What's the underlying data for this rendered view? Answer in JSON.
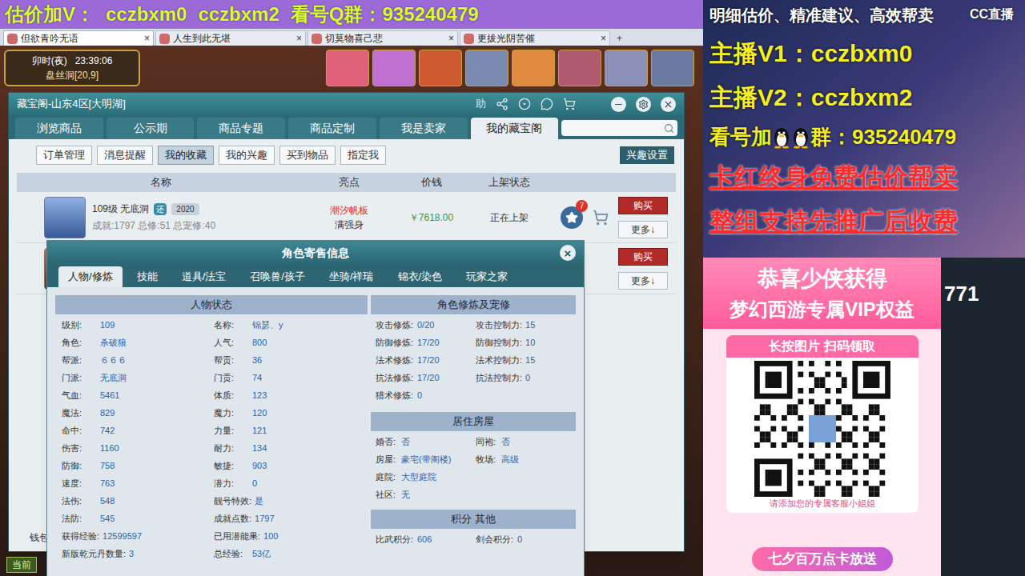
{
  "banner": {
    "label_v": "估价加V：",
    "v1": "cczbxm0",
    "v2": "cczbxm2",
    "label_q": "看号Q群：",
    "q": "935240479"
  },
  "browser_tabs": [
    {
      "label": "但欲青吟无语",
      "selected": true,
      "close": "×"
    },
    {
      "label": "人生到此无堪",
      "selected": false,
      "close": "×"
    },
    {
      "label": "切莫物喜己悲",
      "selected": false,
      "close": "×"
    },
    {
      "label": "更拔光阴苦催",
      "selected": false,
      "close": "×"
    }
  ],
  "new_tab": "+",
  "hud": {
    "period": "卯时(夜)",
    "clock": "23:39:06",
    "location": "盘丝洞[20,9]"
  },
  "window": {
    "title": "藏宝阁-山东4区[大明湖]",
    "help": "助"
  },
  "nav_tabs": [
    {
      "label": "浏览商品",
      "selected": false
    },
    {
      "label": "公示期",
      "selected": false
    },
    {
      "label": "商品专题",
      "selected": false
    },
    {
      "label": "商品定制",
      "selected": false
    },
    {
      "label": "我是卖家",
      "selected": false
    },
    {
      "label": "我的藏宝阁",
      "selected": true
    }
  ],
  "sub_tabs": [
    {
      "label": "订单管理",
      "selected": false
    },
    {
      "label": "消息提醒",
      "selected": false
    },
    {
      "label": "我的收藏",
      "selected": true
    },
    {
      "label": "我的兴趣",
      "selected": false
    },
    {
      "label": "买到物品",
      "selected": false
    },
    {
      "label": "指定我",
      "selected": false
    }
  ],
  "interest_button": "兴趣设置",
  "table": {
    "columns": [
      "名称",
      "亮点",
      "价钱",
      "上架状态"
    ],
    "rows": [
      {
        "title": "109级 无底洞",
        "badges": [
          "还",
          "2020"
        ],
        "summary": "成就:1797 总修:51 总宠修:40",
        "highlights": [
          {
            "text": "潮汐帆板",
            "color": "#e0302a"
          },
          {
            "text": "满强身",
            "color": "#333333"
          }
        ],
        "price": "￥7618.00",
        "status": "正在上架",
        "favorites": "7",
        "buy": "购买",
        "more": "更多↓"
      },
      {
        "title": "",
        "badges": [],
        "summary": "",
        "highlights": [],
        "price": "",
        "status": "",
        "favorites": "",
        "buy": "购买",
        "more": "更多↓"
      }
    ]
  },
  "dialog": {
    "title": "角色寄售信息",
    "close": "×",
    "tabs": [
      {
        "label": "人物/修炼",
        "selected": true
      },
      {
        "label": "技能",
        "selected": false
      },
      {
        "label": "道具/法宝",
        "selected": false
      },
      {
        "label": "召唤兽/孩子",
        "selected": false
      },
      {
        "label": "坐骑/祥瑞",
        "selected": false
      },
      {
        "label": "锦衣/染色",
        "selected": false
      },
      {
        "label": "玩家之家",
        "selected": false
      }
    ],
    "status": {
      "title": "人物状态",
      "rows": [
        [
          {
            "label": "级别:",
            "value": "109"
          },
          {
            "label": "名称:",
            "value": "锦瑟、y"
          }
        ],
        [
          {
            "label": "角色:",
            "value": "杀破狼"
          },
          {
            "label": "人气:",
            "value": "800"
          }
        ],
        [
          {
            "label": "帮派:",
            "value": "６６６"
          },
          {
            "label": "帮贡:",
            "value": "36"
          }
        ],
        [
          {
            "label": "门派:",
            "value": "无底洞"
          },
          {
            "label": "门贡:",
            "value": "74"
          }
        ],
        [
          {
            "label": "气血:",
            "value": "5461"
          },
          {
            "label": "体质:",
            "value": "123"
          }
        ],
        [
          {
            "label": "魔法:",
            "value": "829"
          },
          {
            "label": "魔力:",
            "value": "120"
          }
        ],
        [
          {
            "label": "命中:",
            "value": "742"
          },
          {
            "label": "力量:",
            "value": "121"
          }
        ],
        [
          {
            "label": "伤害:",
            "value": "1160"
          },
          {
            "label": "耐力:",
            "value": "134"
          }
        ],
        [
          {
            "label": "防御:",
            "value": "758"
          },
          {
            "label": "敏捷:",
            "value": "903"
          }
        ],
        [
          {
            "label": "速度:",
            "value": "763"
          },
          {
            "label": "潜力:",
            "value": "0"
          }
        ],
        [
          {
            "label": "法伤:",
            "value": "548"
          },
          {
            "label": "靓号特效:",
            "value": "是"
          }
        ],
        [
          {
            "label": "法防:",
            "value": "545"
          },
          {
            "label": "成就点数:",
            "value": "1797"
          }
        ],
        [
          {
            "label": "获得经验:",
            "value": "12599597"
          },
          {
            "label": "已用潜能果:",
            "value": "100"
          }
        ],
        [
          {
            "label": "新版乾元丹数量:",
            "value": "3"
          },
          {
            "label": "总经验:",
            "value": "53亿"
          }
        ]
      ]
    },
    "cultivation": {
      "title": "角色修炼及宠修",
      "rows": [
        [
          {
            "label": "攻击修炼:",
            "value": "0/20"
          },
          {
            "label": "攻击控制力:",
            "value": "15"
          }
        ],
        [
          {
            "label": "防御修炼:",
            "value": "17/20"
          },
          {
            "label": "防御控制力:",
            "value": "10"
          }
        ],
        [
          {
            "label": "法术修炼:",
            "value": "17/20"
          },
          {
            "label": "法术控制力:",
            "value": "15"
          }
        ],
        [
          {
            "label": "抗法修炼:",
            "value": "17/20"
          },
          {
            "label": "抗法控制力:",
            "value": "0"
          }
        ],
        [
          {
            "label": "猎术修炼:",
            "value": "0"
          }
        ]
      ]
    },
    "house": {
      "title": "居住房屋",
      "rows": [
        [
          {
            "label": "婚否:",
            "value": "否"
          },
          {
            "label": "同袍:",
            "value": "否"
          }
        ],
        [
          {
            "label": "房屋:",
            "value": "豪宅(带阁楼)"
          },
          {
            "label": "牧场:",
            "value": "高级"
          }
        ],
        [
          {
            "label": "庭院:",
            "value": "大型庭院"
          }
        ],
        [
          {
            "label": "社区:",
            "value": "无"
          }
        ]
      ]
    },
    "points": {
      "title": "积分 其他",
      "rows": [
        [
          {
            "label": "比武积分:",
            "value": "606"
          },
          {
            "label": "剑会积分:",
            "value": "0"
          }
        ]
      ]
    }
  },
  "footer": {
    "wallet": "钱包",
    "chat_channel": "当前"
  },
  "side": {
    "slogan": "明细估价、精准建议、高效帮卖",
    "logo": "CC直播",
    "anchors": [
      "主播V1：cczbxm0",
      "主播V2：cczbxm2"
    ],
    "qq": {
      "prefix": "看号加",
      "suffix": "群：935240479"
    },
    "promos": [
      "卡红终身免费估价帮卖",
      "整组支持先推广后收费"
    ],
    "card": {
      "line1": "恭喜少侠获得",
      "line2": "梦幻西游专属VIP权益",
      "scan": "长按图片 扫码领取",
      "hint": "请添加您的专属客服小姐姐",
      "button": "七夕百万点卡放送"
    },
    "background_number": "771"
  }
}
